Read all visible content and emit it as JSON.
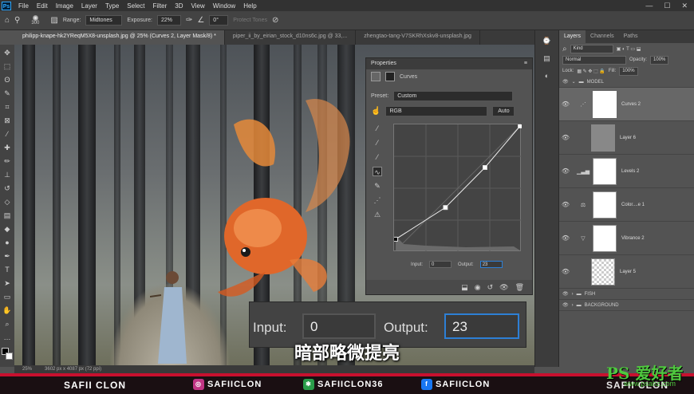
{
  "menubar": {
    "app_logo": "Ps",
    "items": [
      "File",
      "Edit",
      "Image",
      "Layer",
      "Type",
      "Select",
      "Filter",
      "3D",
      "View",
      "Window",
      "Help"
    ],
    "window_controls": [
      "—",
      "☐",
      "✕"
    ]
  },
  "options": {
    "brush_size": "300",
    "range_label": "Range:",
    "range_value": "Midtones",
    "exposure_label": "Exposure:",
    "exposure_value": "22%",
    "angle_value": "0°",
    "protect_tones": "Protect Tones"
  },
  "tabs": [
    "philipp-knape-hk2YReqM5X8-unsplash.jpg @ 25% (Curves 2, Layer Mask/8) *",
    "piper_ii_by_eirian_stock_d10ns6c.jpg @ 33,...",
    "zhengtao-tang-V7SKRhXskv8-unsplash.jpg"
  ],
  "status": {
    "zoom": "25%",
    "doc": "3602 px x 4087 px (72 ppi)"
  },
  "properties": {
    "title": "Properties",
    "subtitle": "Curves",
    "preset_label": "Preset:",
    "preset_value": "Custom",
    "channel": "RGB",
    "auto_btn": "Auto",
    "input_label": "Input:",
    "input_value": "0",
    "output_label": "Output:",
    "output_value": "23"
  },
  "zoom_callout": {
    "input_label": "Input:",
    "input_value": "0",
    "output_label": "Output:",
    "output_value": "23"
  },
  "subtitle": "暗部略微提亮",
  "layers_panel": {
    "tabs": [
      "Layers",
      "Channels",
      "Paths"
    ],
    "kind": "Kind",
    "blend_mode": "Normal",
    "opacity_label": "Opacity:",
    "opacity_value": "100%",
    "lock_label": "Lock:",
    "fill_label": "Fill:",
    "fill_value": "100%",
    "groups_top": [
      "MODEL"
    ],
    "layers": [
      {
        "name": "Curves 2"
      },
      {
        "name": "Layer 6"
      },
      {
        "name": "Levels 2"
      },
      {
        "name": "Color....e 1"
      },
      {
        "name": "Vibrance 2"
      },
      {
        "name": "Layer 5"
      }
    ],
    "groups_bottom": [
      "FISH",
      "BACKGROUND"
    ]
  },
  "banner": {
    "name": "SAFII CLON",
    "instagram": "SAFIICLON",
    "other": "SAFIICLON36",
    "facebook": "SAFIICLON",
    "name_right": "SAFII CLON"
  },
  "watermark": {
    "logo": "PS 爱好者",
    "site": "www.psahz.com"
  },
  "curve": {
    "points": [
      [
        0,
        23
      ],
      [
        102,
        88
      ],
      [
        183,
        170
      ],
      [
        255,
        255
      ]
    ],
    "range": [
      0,
      255
    ]
  }
}
